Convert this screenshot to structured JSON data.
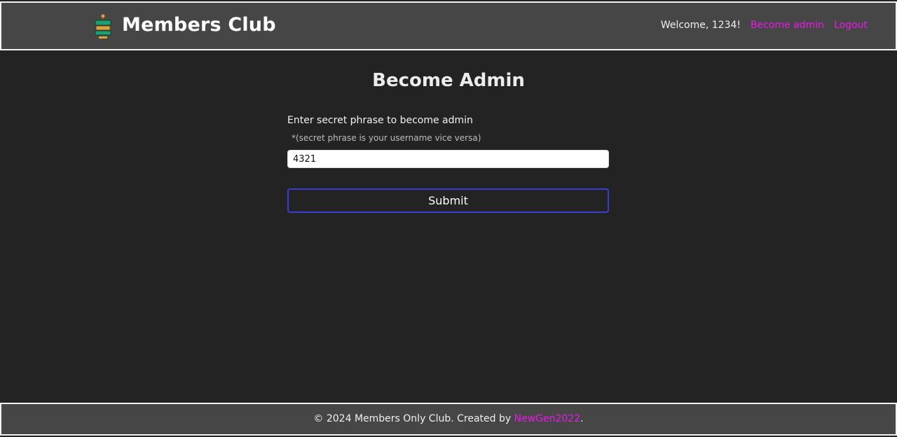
{
  "header": {
    "title": "Members Club",
    "logo_icon": "members-club-logo",
    "welcome": "Welcome, 1234!",
    "become_admin": "Become admin",
    "logout": "Logout"
  },
  "main": {
    "title": "Become Admin",
    "label": "Enter secret phrase to become admin",
    "hint": "*(secret phrase is your username vice versa)",
    "input_value": "4321",
    "submit": "Submit"
  },
  "footer": {
    "prefix": "© 2024 Members Only Club. Created by ",
    "author": "NewGen2022",
    "suffix": "."
  },
  "colors": {
    "background": "#232323",
    "bar": "#464646",
    "accent": "#e81ae8",
    "button_border": "#3b3bd6"
  }
}
